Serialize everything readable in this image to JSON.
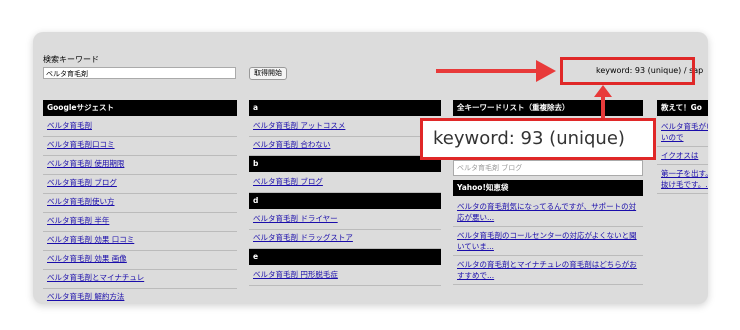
{
  "search": {
    "label": "検索キーワード",
    "value": "ベルタ育毛剤",
    "button": "取得開始"
  },
  "status": {
    "count_text": "keyword: 93 (unique) / sap",
    "zoom_text": "keyword: 93 (unique)"
  },
  "columns": {
    "google": {
      "header": "Googleサジェスト",
      "items": [
        "ベルタ育毛剤",
        "ベルタ育毛剤口コミ",
        "ベルタ育毛剤 使用期限",
        "ベルタ育毛剤 ブログ",
        "ベルタ育毛剤使い方",
        "ベルタ育毛剤 半年",
        "ベルタ育毛剤 効果 口コミ",
        "ベルタ育毛剤 効果 画像",
        "ベルタ育毛剤とマイナチュレ",
        "ベルタ育毛剤 解約方法"
      ]
    },
    "alpha": {
      "sections": [
        {
          "header": "a",
          "items": [
            "ベルタ育毛剤 アットコスメ",
            "ベルタ育毛剤 合わない"
          ]
        },
        {
          "header": "b",
          "items": [
            "ベルタ育毛剤 ブログ"
          ]
        },
        {
          "header": "d",
          "items": [
            "ベルタ育毛剤 ドライヤー",
            "ベルタ育毛剤 ドラッグストア"
          ]
        },
        {
          "header": "e",
          "items": [
            "ベルタ育毛剤 円形脱毛症"
          ]
        }
      ]
    },
    "all": {
      "header": "全キーワードリスト（重複除去）",
      "textarea": "ベルタ育毛剤 ブログ",
      "yahoo_header": "Yahoo!知恵袋",
      "yahoo_items": [
        "ベルタの育毛剤気になってるんですが、サポートの対応が悪い...",
        "ベルタ育毛剤のコールセンターの対応がよくないと聞いていま...",
        "ベルタの育毛剤とマイナチュレの育毛剤はどちらがおすすめで..."
      ]
    },
    "oshiete": {
      "header": "教えて！Go",
      "items": [
        "ベルタ育毛がいいので",
        "イクオスは",
        "第一子を出す。抜け毛です。..."
      ]
    }
  },
  "colors": {
    "accent": "#e02828",
    "link": "#1a0dab",
    "header_bg": "#000000"
  }
}
